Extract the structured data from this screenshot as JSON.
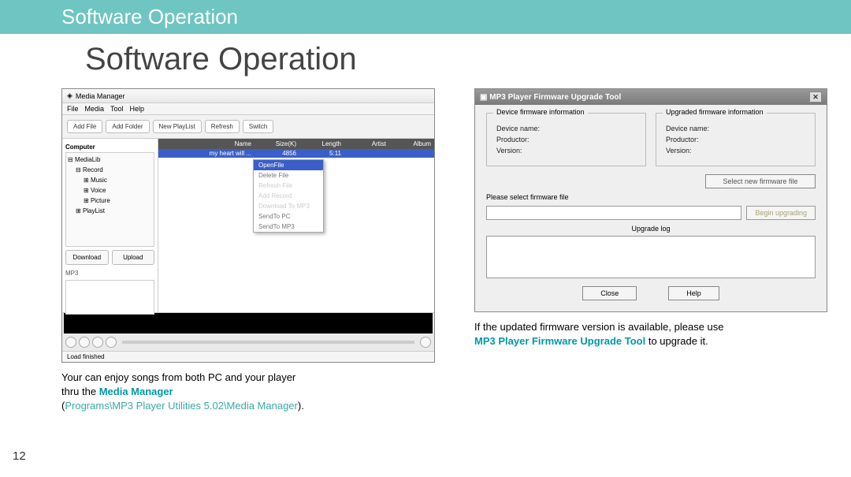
{
  "header_bar": "Software Operation",
  "page_title": "Software Operation",
  "page_number": "12",
  "media_manager": {
    "title": "Media Manager",
    "menu": [
      "File",
      "Media",
      "Tool",
      "Help"
    ],
    "toolbar": [
      "Add File",
      "Add Folder",
      "New PlayList",
      "Refresh",
      "Switch"
    ],
    "tree_header": "Computer",
    "tree": {
      "root": "MediaLib",
      "items": [
        "Record",
        "Music",
        "Voice",
        "Picture",
        "PlayList"
      ]
    },
    "download_btn": "Download",
    "upload_btn": "Upload",
    "mp3_label": "MP3",
    "list_header": {
      "name": "Name",
      "c1": "Size(K)",
      "c2": "Length",
      "c3": "Artist",
      "c4": "Album"
    },
    "row": {
      "name": "my heart will ...",
      "c1": "4856",
      "c2": "5:11",
      "c3": "",
      "c4": ""
    },
    "context_menu": [
      "OpenFile",
      "Delete File",
      "Refresh File",
      "Add Record",
      "Download To MP3",
      "SendTo PC",
      "SendTo MP3"
    ],
    "status": "Load finished"
  },
  "firmware_tool": {
    "title": "MP3 Player Firmware Upgrade Tool",
    "grp1_title": "Device firmware information",
    "grp2_title": "Upgraded firmware information",
    "device_name": "Device name:",
    "productor": "Productor:",
    "version": "Version:",
    "select_new": "Select new firmware file",
    "please_select": "Please select firmware file",
    "begin": "Begin upgrading",
    "upgrade_log": "Upgrade log",
    "close": "Close",
    "help": "Help"
  },
  "caption_left": {
    "line1": "Your can enjoy songs from both PC and your player",
    "line2a": "thru the ",
    "line2b": "Media Manager",
    "line3a": "(",
    "line3b": "Programs\\MP3 Player Utilities 5.02\\Media Manager",
    "line3c": ")."
  },
  "caption_right": {
    "line1": "If the updated firmware version is available, please use",
    "line2a": "MP3 Player Firmware Upgrade Tool",
    "line2b": " to upgrade it."
  }
}
